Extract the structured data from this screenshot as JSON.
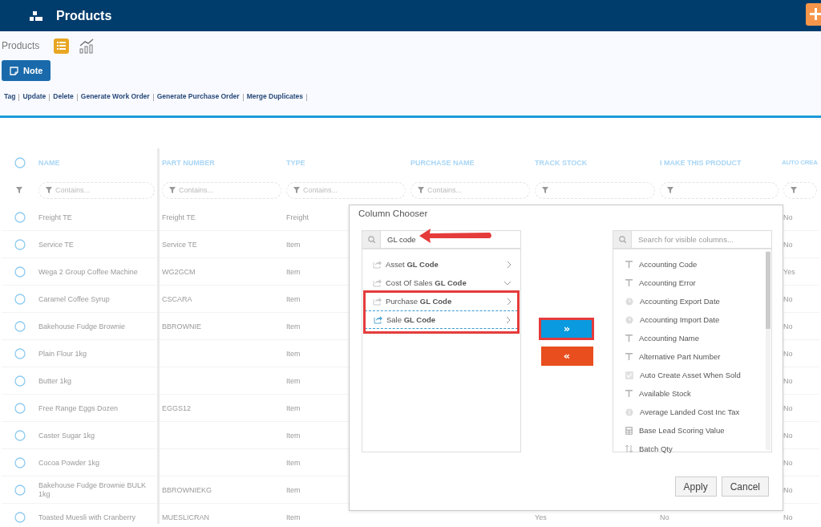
{
  "header": {
    "title": "Products"
  },
  "toolbar": {
    "label": "Products",
    "views": [
      {
        "kind": "list",
        "selected": true
      },
      {
        "kind": "chart",
        "selected": false
      }
    ],
    "note_button": "Note",
    "actions": [
      "Tag",
      "Update",
      "Delete",
      "Generate Work Order",
      "Generate Purchase Order",
      "Merge Duplicates"
    ]
  },
  "table": {
    "all_checked": false,
    "columns": [
      {
        "label": "NAME",
        "placeholder": "Contains..."
      },
      {
        "label": "PART NUMBER",
        "placeholder": "Contains..."
      },
      {
        "label": "TYPE",
        "placeholder": "Contains..."
      },
      {
        "label": "PURCHASE NAME",
        "placeholder": "Contains..."
      },
      {
        "label": "TRACK STOCK"
      },
      {
        "label": "I MAKE THIS PRODUCT"
      },
      {
        "label": "AUTO CREA"
      }
    ],
    "rows": [
      {
        "cells": [
          "Freight TE",
          "Freight TE",
          "Freight",
          null,
          null,
          null,
          "No"
        ],
        "checked": false
      },
      {
        "cells": [
          "Service TE",
          "Service TE",
          "Item",
          null,
          null,
          null,
          "No"
        ],
        "checked": false
      },
      {
        "cells": [
          "Wega 2 Group Coffee Machine",
          "WG2GCM",
          "Item",
          null,
          null,
          null,
          "Yes"
        ],
        "checked": false
      },
      {
        "cells": [
          "Caramel Coffee Syrup",
          "CSCARA",
          "Item",
          null,
          null,
          null,
          "No"
        ],
        "checked": false
      },
      {
        "cells": [
          "Bakehouse Fudge Brownie",
          "BBROWNIE",
          "Item",
          null,
          null,
          null,
          "No"
        ],
        "checked": false
      },
      {
        "cells": [
          "Plain Flour 1kg",
          null,
          "Item",
          null,
          null,
          null,
          "No"
        ],
        "checked": false
      },
      {
        "cells": [
          "Butter 1kg",
          null,
          "Item",
          null,
          null,
          null,
          "No"
        ],
        "checked": false
      },
      {
        "cells": [
          "Free Range Eggs Dozen",
          "EGGS12",
          "Item",
          null,
          null,
          null,
          "No"
        ],
        "checked": false
      },
      {
        "cells": [
          "Caster Sugar 1kg",
          null,
          "Item",
          null,
          null,
          null,
          "No"
        ],
        "checked": false
      },
      {
        "cells": [
          "Cocoa Powder 1kg",
          null,
          "Item",
          null,
          null,
          null,
          "No"
        ],
        "checked": false
      },
      {
        "cells": [
          "Bakehouse Fudge Brownie BULK 1kg",
          "BBROWNIEKG",
          "Item",
          null,
          null,
          null,
          "No"
        ],
        "checked": false
      },
      {
        "cells": [
          "Toasted Muesli with Cranberry",
          "MUESLICRAN",
          "Item",
          null,
          "Yes",
          "No",
          "No"
        ],
        "checked": false
      }
    ]
  },
  "column_chooser": {
    "title": "Column Chooser",
    "hidden_search": {
      "value": "GL code"
    },
    "hidden_columns": [
      {
        "label": "Asset **GL Code**",
        "expanded": false,
        "focused": false
      },
      {
        "label": "Cost Of Sales **GL Code**",
        "expanded": true,
        "focused": false
      },
      {
        "label": "Purchase **GL Code**",
        "expanded": false,
        "focused": false
      },
      {
        "label": "Sale **GL Code**",
        "expanded": false,
        "focused": true
      }
    ],
    "visible_search": {
      "placeholder": "Search for visible columns..."
    },
    "visible_columns": [
      {
        "label": "Accounting Code",
        "kind": "text"
      },
      {
        "label": "Accounting Error",
        "kind": "text"
      },
      {
        "label": "Accounting Export Date",
        "kind": "date"
      },
      {
        "label": "Accounting Import Date",
        "kind": "date"
      },
      {
        "label": "Accounting Name",
        "kind": "text"
      },
      {
        "label": "Alternative Part Number",
        "kind": "text"
      },
      {
        "label": "Auto Create Asset When Sold",
        "kind": "boolean"
      },
      {
        "label": "Available Stock",
        "kind": "text"
      },
      {
        "label": "Average Landed Cost Inc Tax",
        "kind": "currency"
      },
      {
        "label": "Base Lead Scoring Value",
        "kind": "calculated"
      },
      {
        "label": "Batch Qty",
        "kind": "number"
      }
    ],
    "move_right": "»",
    "move_left": "«",
    "buttons": [
      "Apply",
      "Cancel"
    ]
  }
}
